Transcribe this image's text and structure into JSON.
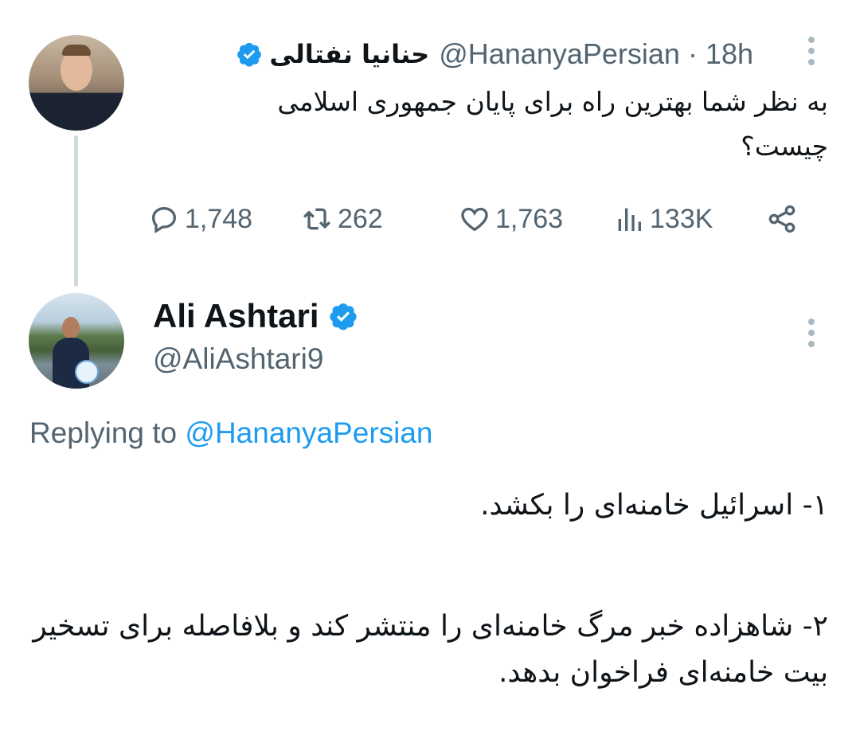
{
  "original_tweet": {
    "display_name": "حنانیا نفتالی",
    "handle": "@HananyaPersian",
    "time": "· 18h",
    "verified": true,
    "text": "به نظر شما بهترین راه برای پایان جمهوری اسلامی چیست؟",
    "stats": {
      "replies": "1,748",
      "retweets": "262",
      "likes": "1,763",
      "views": "133K"
    }
  },
  "reply_tweet": {
    "display_name": "Ali Ashtari",
    "handle": "@AliAshtari9",
    "verified": true,
    "replying_prefix": "Replying to",
    "replying_to": "@HananyaPersian",
    "paragraph_1": "۱- اسرائیل خامنه‌ای را بکشد.",
    "paragraph_2": "۲- شاهزاده خبر مرگ خامنه‌ای را منتشر کند و بلافاصله برای تسخیر بیت خامنه‌ای فراخوان بدهد."
  },
  "colors": {
    "verified_blue": "#1d9bf0",
    "secondary_text": "#536471",
    "primary_text": "#0f1419",
    "thread_line": "#cfd9de"
  },
  "icons": [
    "verified-badge-icon",
    "more-icon",
    "reply-icon",
    "retweet-icon",
    "like-icon",
    "views-icon",
    "share-icon"
  ]
}
